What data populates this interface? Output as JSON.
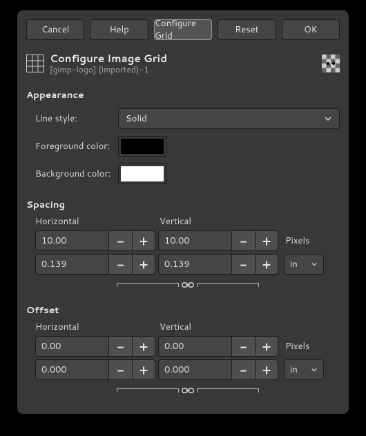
{
  "buttons": {
    "cancel": "Cancel",
    "help": "Help",
    "configure_grid": "Configure Grid",
    "reset": "Reset",
    "ok": "OK"
  },
  "header": {
    "title": "Configure Image Grid",
    "subtitle": "[gimp-logo] (imported)-1"
  },
  "appearance": {
    "section": "Appearance",
    "line_style_label": "Line style:",
    "line_style_value": "Solid",
    "fg_label": "Foreground color:",
    "bg_label": "Background color:"
  },
  "spacing": {
    "section": "Spacing",
    "horizontal_label": "Horizontal",
    "vertical_label": "Vertical",
    "h_px": "10.00",
    "v_px": "10.00",
    "px_unit": "Pixels",
    "h_unit": "0.139",
    "v_unit": "0.139",
    "unit": "in"
  },
  "offset": {
    "section": "Offset",
    "horizontal_label": "Horizontal",
    "vertical_label": "Vertical",
    "h_px": "0.00",
    "v_px": "0.00",
    "px_unit": "Pixels",
    "h_unit": "0.000",
    "v_unit": "0.000",
    "unit": "in"
  }
}
